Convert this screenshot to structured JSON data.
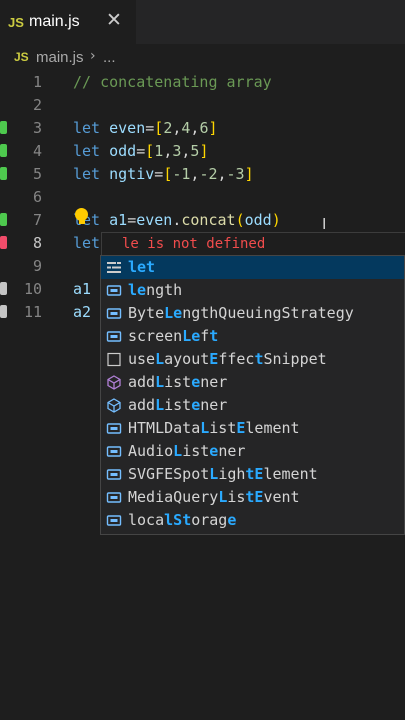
{
  "tab": {
    "badge": "JS",
    "filename": "main.js",
    "close": "✕"
  },
  "breadcrumb": {
    "badge": "JS",
    "file": "main.js",
    "separator": "›",
    "more": "..."
  },
  "lines": [
    {
      "n": "1",
      "text": "// concatenating array"
    },
    {
      "n": "2",
      "text": ""
    },
    {
      "n": "3",
      "text": "let even=[2,4,6]"
    },
    {
      "n": "4",
      "text": "let odd=[1,3,5]"
    },
    {
      "n": "5",
      "text": "let ngtiv=[-1,-2,-3]"
    },
    {
      "n": "6",
      "text": ""
    },
    {
      "n": "7",
      "text": "let a1=even.concat(odd)"
    },
    {
      "n": "8",
      "text": "let"
    },
    {
      "n": "9",
      "text": ""
    },
    {
      "n": "10",
      "text": "a1"
    },
    {
      "n": "11",
      "text": "a2"
    }
  ],
  "error_hint": "le is not defined",
  "suggestions": [
    {
      "label": "let",
      "kind": "keyword"
    },
    {
      "label": "length",
      "kind": "property"
    },
    {
      "label": "ByteLengthQueuingStrategy",
      "kind": "property"
    },
    {
      "label": "screenLeft",
      "kind": "property"
    },
    {
      "label": "useLayoutEffectSnippet",
      "kind": "snippet"
    },
    {
      "label": "addListener",
      "kind": "method"
    },
    {
      "label": "addListener",
      "kind": "method"
    },
    {
      "label": "HTMLDataListElement",
      "kind": "property"
    },
    {
      "label": "AudioListener",
      "kind": "property"
    },
    {
      "label": "SVGFESpotLightElement",
      "kind": "property"
    },
    {
      "label": "MediaQueryListEvent",
      "kind": "property"
    },
    {
      "label": "localStorage",
      "kind": "property"
    }
  ],
  "colors": {
    "added": "#4ec94e",
    "modified": "#f14c6a",
    "accent": "#2aaaff",
    "error": "#f14c4c"
  }
}
